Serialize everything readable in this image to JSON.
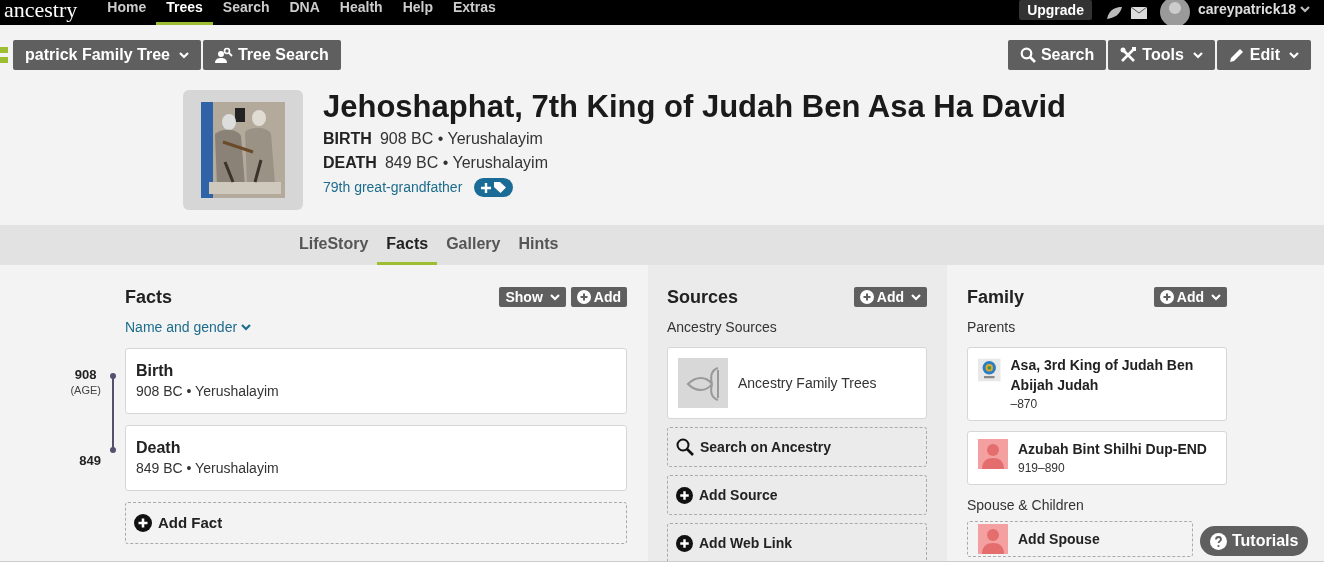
{
  "nav": {
    "logo": "ancestry",
    "items": [
      {
        "label": "Home",
        "selected": false
      },
      {
        "label": "Trees",
        "selected": true
      },
      {
        "label": "Search",
        "selected": false
      },
      {
        "label": "DNA",
        "selected": false
      },
      {
        "label": "Health",
        "selected": false
      },
      {
        "label": "Help",
        "selected": false
      },
      {
        "label": "Extras",
        "selected": false
      }
    ],
    "upgrade": "Upgrade",
    "username": "careypatrick18"
  },
  "toolbar": {
    "left": [
      {
        "kind": "tree",
        "label": "patrick Family Tree",
        "dropdown": true
      },
      {
        "kind": "person-search",
        "label": "Tree Search",
        "dropdown": false
      }
    ],
    "right": [
      {
        "kind": "search",
        "label": "Search",
        "dropdown": false
      },
      {
        "kind": "tools",
        "label": "Tools",
        "dropdown": true
      },
      {
        "kind": "edit",
        "label": "Edit",
        "dropdown": true
      }
    ]
  },
  "person": {
    "name": "Jehoshaphat, 7th King of Judah Ben Asa Ha David",
    "events": [
      {
        "label": "BIRTH",
        "value": "908 BC • Yerushalayim"
      },
      {
        "label": "DEATH",
        "value": "849 BC • Yerushalayim"
      }
    ],
    "relation": "79th great-grandfather"
  },
  "tabs": [
    {
      "label": "LifeStory",
      "selected": false
    },
    {
      "label": "Facts",
      "selected": true
    },
    {
      "label": "Gallery",
      "selected": false
    },
    {
      "label": "Hints",
      "selected": false
    }
  ],
  "facts": {
    "title": "Facts",
    "show": "Show",
    "add": "Add",
    "filter": "Name and gender",
    "timeline": [
      {
        "year": "908",
        "note": "(AGE)"
      },
      {
        "year": "849"
      }
    ],
    "items": [
      {
        "title": "Birth",
        "detail": "908 BC • Yerushalayim"
      },
      {
        "title": "Death",
        "detail": "849 BC • Yerushalayim"
      }
    ],
    "add_fact": "Add Fact"
  },
  "sources": {
    "title": "Sources",
    "add": "Add",
    "group": "Ancestry Sources",
    "items": [
      {
        "title": "Ancestry Family Trees"
      }
    ],
    "actions": [
      {
        "kind": "search",
        "label": "Search on Ancestry"
      },
      {
        "kind": "add",
        "label": "Add Source"
      },
      {
        "kind": "add",
        "label": "Add Web Link"
      }
    ]
  },
  "family": {
    "title": "Family",
    "add": "Add",
    "parents_label": "Parents",
    "parents": [
      {
        "name": "Asa, 3rd King of Judah Ben Abijah Judah",
        "years": "–870"
      },
      {
        "kind": "placeholder",
        "name": "Azubah Bint Shilhi Dup-END",
        "years": "919–890"
      }
    ],
    "spouse_label": "Spouse & Children",
    "add_spouse": "Add Spouse"
  },
  "tutorials": "Tutorials"
}
